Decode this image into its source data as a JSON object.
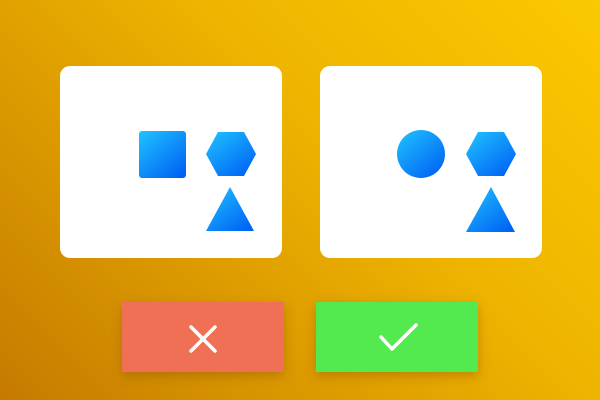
{
  "colors": {
    "background_top_right": "#fbc900",
    "background_bottom_left": "#c57a00",
    "card": "#ffffff",
    "shape_gradient_light": "#20c4ff",
    "shape_gradient_dark": "#0062f5",
    "reject": "#f07055",
    "accept": "#53ea50",
    "button_icon": "#ffffff"
  },
  "left_panel": {
    "shapes": [
      "square",
      "hexagon",
      "triangle"
    ]
  },
  "right_panel": {
    "shapes": [
      "circle",
      "hexagon",
      "triangle"
    ]
  },
  "buttons": {
    "reject": {
      "icon": "close-icon"
    },
    "accept": {
      "icon": "checkmark-icon"
    }
  }
}
